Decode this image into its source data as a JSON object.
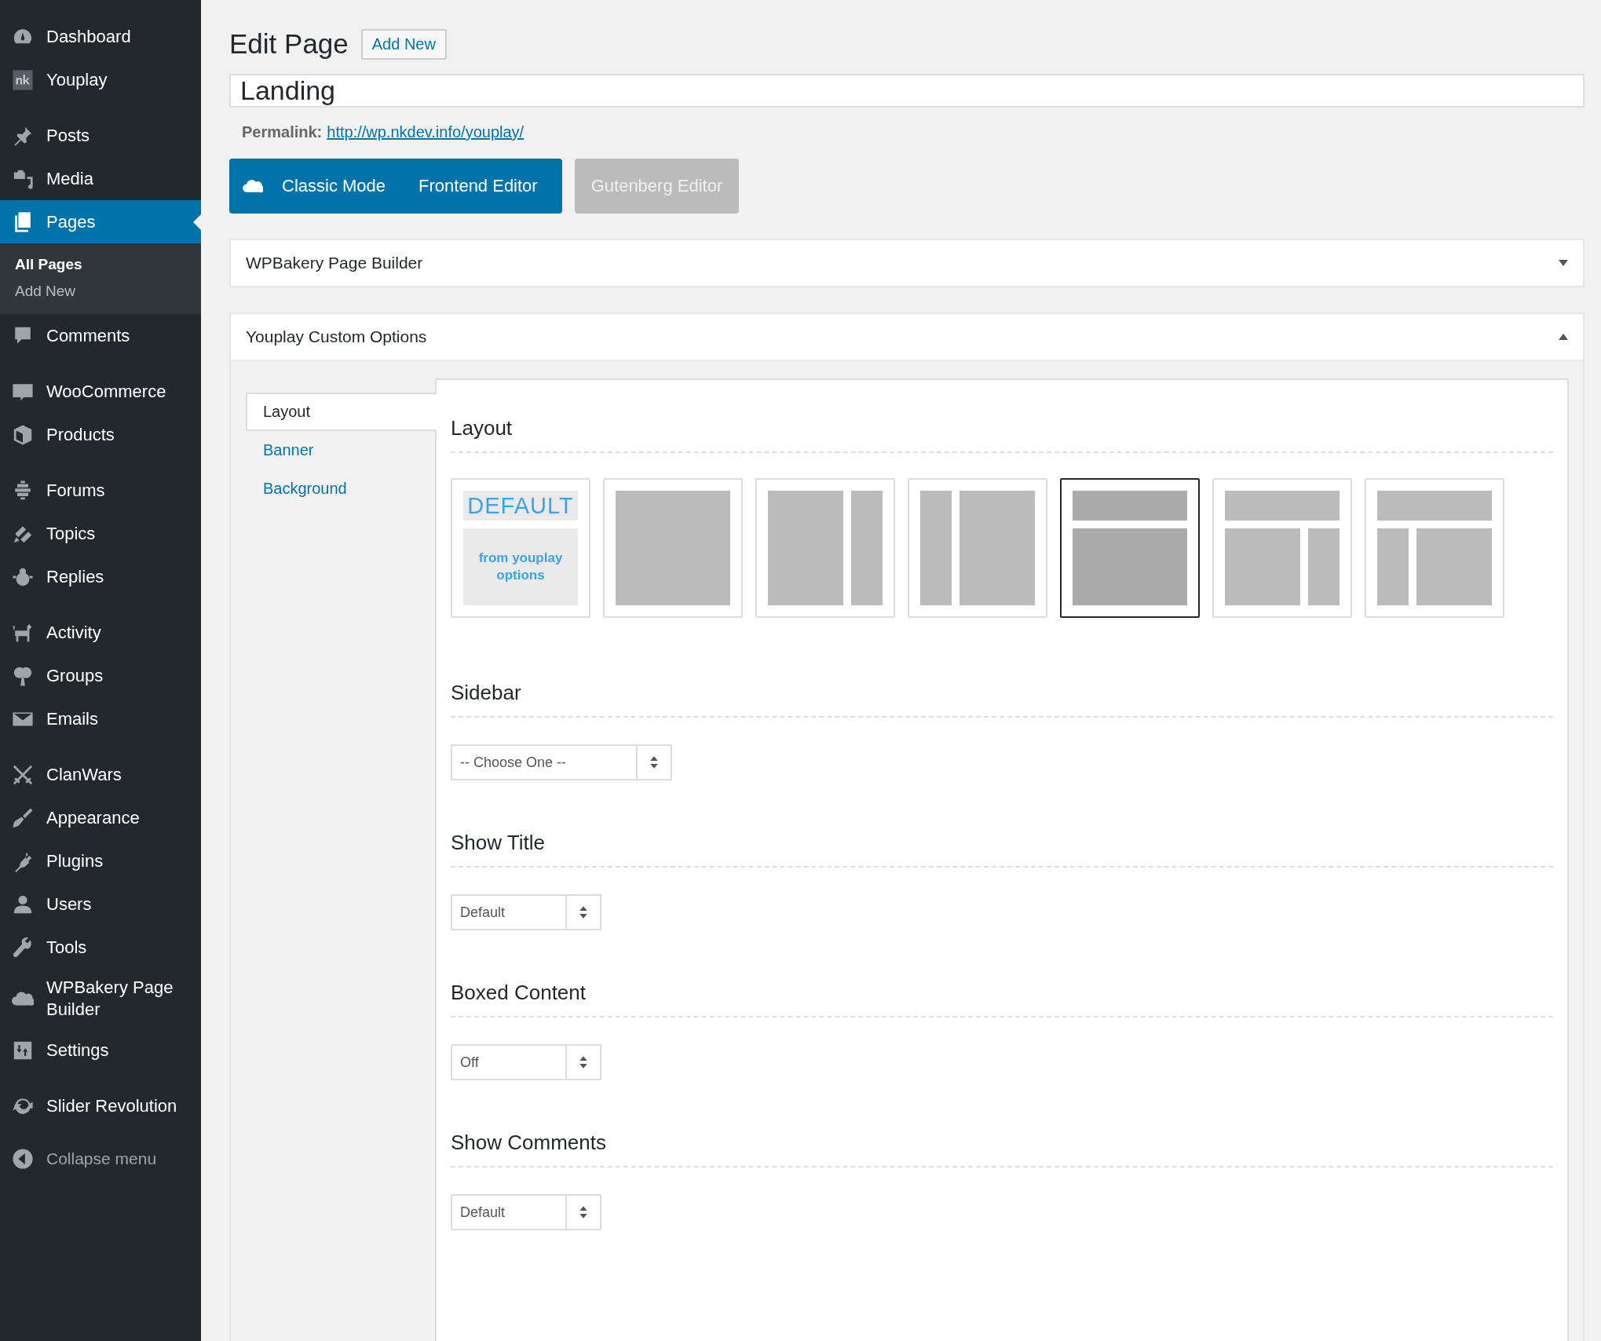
{
  "sidebar": {
    "groups": [
      [
        {
          "label": "Dashboard",
          "selected": false
        },
        {
          "label": "Youplay",
          "selected": false
        }
      ],
      [
        {
          "label": "Posts",
          "selected": false
        },
        {
          "label": "Media",
          "selected": false
        },
        {
          "label": "Pages",
          "selected": true,
          "children": [
            {
              "label": "All Pages",
              "selected": true
            },
            {
              "label": "Add New",
              "selected": false
            }
          ]
        },
        {
          "label": "Comments",
          "selected": false
        }
      ],
      [
        {
          "label": "WooCommerce",
          "selected": false
        },
        {
          "label": "Products",
          "selected": false
        }
      ],
      [
        {
          "label": "Forums",
          "selected": false
        },
        {
          "label": "Topics",
          "selected": false
        },
        {
          "label": "Replies",
          "selected": false
        }
      ],
      [
        {
          "label": "Activity",
          "selected": false
        },
        {
          "label": "Groups",
          "selected": false
        },
        {
          "label": "Emails",
          "selected": false
        }
      ],
      [
        {
          "label": "ClanWars",
          "selected": false
        },
        {
          "label": "Appearance",
          "selected": false
        },
        {
          "label": "Plugins",
          "selected": false
        },
        {
          "label": "Users",
          "selected": false
        },
        {
          "label": "Tools",
          "selected": false
        },
        {
          "label": "WPBakery Page Builder",
          "selected": false
        },
        {
          "label": "Settings",
          "selected": false
        }
      ],
      [
        {
          "label": "Slider Revolution",
          "selected": false
        }
      ]
    ],
    "collapse": "Collapse menu"
  },
  "header": {
    "title": "Edit Page",
    "add_new": "Add New"
  },
  "title_field": {
    "value": "Landing"
  },
  "permalink": {
    "label": "Permalink:",
    "url": "http://wp.nkdev.info/youplay/"
  },
  "editor_buttons": {
    "classic": "Classic Mode",
    "frontend": "Frontend Editor",
    "gutenberg": "Gutenberg Editor"
  },
  "boxes": [
    {
      "title": "WPBakery Page Builder",
      "expanded": false
    },
    {
      "title": "Youplay Custom Options",
      "expanded": true
    }
  ],
  "options_tabs": [
    {
      "label": "Layout",
      "selected": true
    },
    {
      "label": "Banner",
      "selected": false
    },
    {
      "label": "Background",
      "selected": false
    }
  ],
  "layout": {
    "heading": "Layout",
    "options": [
      {
        "kind": "default",
        "title": "DEFAULT",
        "subtitle": "from youplay options",
        "selected": false
      },
      {
        "kind": "full",
        "selected": false
      },
      {
        "kind": "right-sidebar",
        "selected": false
      },
      {
        "kind": "left-sidebar",
        "selected": false
      },
      {
        "kind": "banner-full",
        "selected": true
      },
      {
        "kind": "banner-right",
        "selected": false
      },
      {
        "kind": "banner-left",
        "selected": false
      }
    ]
  },
  "fields": [
    {
      "heading": "Sidebar",
      "value": "-- Choose One --"
    },
    {
      "heading": "Show Title",
      "value": "Default"
    },
    {
      "heading": "Boxed Content",
      "value": "Off"
    },
    {
      "heading": "Show Comments",
      "value": "Default"
    }
  ]
}
